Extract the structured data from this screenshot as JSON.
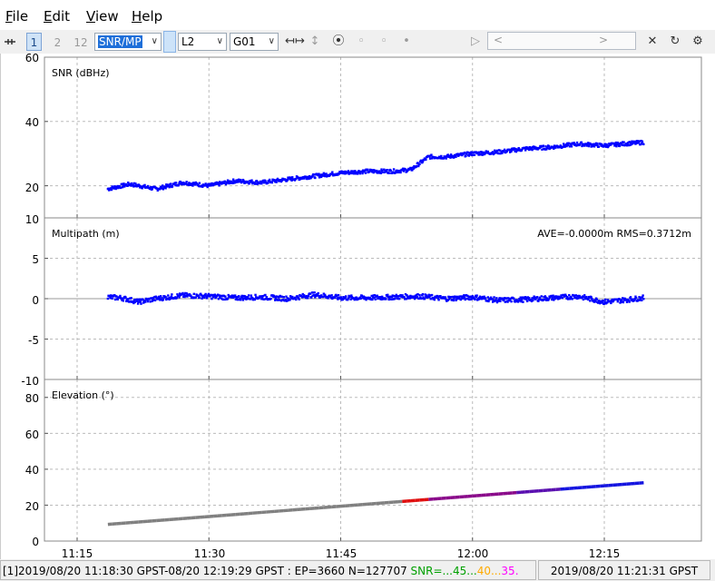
{
  "menu": {
    "file": {
      "mnemonic": "F",
      "rest": "ile"
    },
    "edit": {
      "mnemonic": "E",
      "rest": "dit"
    },
    "view": {
      "mnemonic": "V",
      "rest": "iew"
    },
    "help": {
      "mnemonic": "H",
      "rest": "elp"
    }
  },
  "toolbar": {
    "frame_1": "1",
    "frame_2": "2",
    "frame_12": "12",
    "plot_type": "SNR/MP",
    "frequency": "L2",
    "satellite": "G01",
    "slider_left_arrow": "<",
    "slider_right_arrow": ">"
  },
  "plots": {
    "snr": {
      "label": "SNR (dBHz)",
      "y_ticks": [
        "60",
        "40",
        "20",
        "10"
      ]
    },
    "multipath": {
      "label": "Multipath (m)",
      "stats": "AVE=-0.0000m RMS=0.3712m",
      "y_ticks": [
        "5",
        "0",
        "-5",
        "-10"
      ]
    },
    "elevation": {
      "label": "Elevation (°)",
      "y_ticks": [
        "80",
        "60",
        "40",
        "20",
        "0"
      ]
    },
    "x_ticks": [
      "11:15",
      "11:30",
      "11:45",
      "12:00",
      "12:15"
    ]
  },
  "status": {
    "range_text": "[1]2019/08/20 11:18:30 GPST-08/20 12:19:29 GPST : EP=3660 N=127707 ",
    "snr_legend": [
      {
        "text": "SNR=...",
        "color": "#00a000"
      },
      {
        "text": "45...",
        "color": "#00a000"
      },
      {
        "text": "40...",
        "color": "#ffaa00"
      },
      {
        "text": "35.",
        "color": "#ff00ff"
      }
    ],
    "current_time": "2019/08/20 11:21:31 GPST"
  },
  "chart_data": [
    {
      "type": "scatter",
      "title": "SNR (dBHz)",
      "xlabel": "",
      "ylabel": "",
      "x_ticks": [
        "11:15",
        "11:30",
        "11:45",
        "12:00",
        "12:15"
      ],
      "ylim": [
        10,
        60
      ],
      "grid": true,
      "series": [
        {
          "color": "#0000ff",
          "x": [
            "11:18:30",
            "11:21",
            "11:24",
            "11:27",
            "11:30",
            "11:33",
            "11:36",
            "11:39",
            "11:42",
            "11:45",
            "11:48",
            "11:51",
            "11:53",
            "11:55",
            "11:57",
            "12:00",
            "12:03",
            "12:06",
            "12:09",
            "12:12",
            "12:15",
            "12:17",
            "12:19:29"
          ],
          "values": [
            19,
            20.5,
            19,
            21,
            20,
            21.5,
            21,
            22,
            23,
            24,
            24.5,
            24.5,
            25,
            29,
            29,
            30,
            30.5,
            31.5,
            32,
            33,
            32.5,
            33,
            33.5
          ]
        }
      ]
    },
    {
      "type": "scatter",
      "title": "Multipath (m)",
      "annotation": "AVE=-0.0000m RMS=0.3712m",
      "x_ticks": [
        "11:15",
        "11:30",
        "11:45",
        "12:00",
        "12:15"
      ],
      "ylim": [
        -10,
        10
      ],
      "grid": true,
      "series": [
        {
          "color": "#0000ff",
          "x": [
            "11:18:30",
            "11:20",
            "11:22",
            "11:24",
            "11:27",
            "11:30",
            "11:33",
            "11:36",
            "11:39",
            "11:42",
            "11:45",
            "11:48",
            "11:51",
            "11:54",
            "11:57",
            "12:00",
            "12:03",
            "12:06",
            "12:09",
            "12:12",
            "12:15",
            "12:17",
            "12:19:29"
          ],
          "values": [
            0.2,
            0.1,
            -0.4,
            0.0,
            0.4,
            0.3,
            0.1,
            0.2,
            0.0,
            0.5,
            0.1,
            0.1,
            0.2,
            0.3,
            0.0,
            0.2,
            -0.2,
            -0.1,
            0.1,
            0.3,
            -0.4,
            -0.2,
            0.1
          ]
        }
      ]
    },
    {
      "type": "line",
      "title": "Elevation (°)",
      "x_ticks": [
        "11:15",
        "11:30",
        "11:45",
        "12:00",
        "12:15"
      ],
      "ylim": [
        0,
        90
      ],
      "grid": true,
      "series": [
        {
          "x": [
            "11:18:30",
            "12:19:29"
          ],
          "values": [
            9.3,
            32.5
          ]
        }
      ]
    }
  ]
}
